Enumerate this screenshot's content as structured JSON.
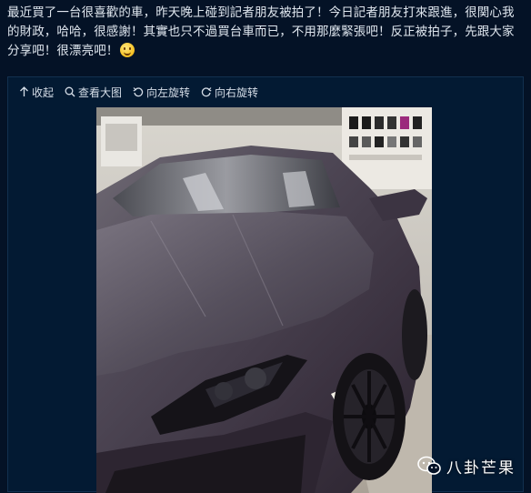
{
  "post": {
    "text": "最近買了一台很喜歡的車，昨天晚上碰到記者朋友被拍了！今日記者朋友打來跟進，很関心我的財政，哈哈，很感謝！其實也只不過買台車而已，不用那麼緊張吧！反正被拍子，先跟大家分享吧！很漂亮吧！",
    "emoji": "smile-emoji"
  },
  "toolbar": {
    "collapse_label": "收起",
    "view_large_label": "查看大图",
    "rotate_left_label": "向左旋转",
    "rotate_right_label": "向右旋转"
  },
  "photo": {
    "subject": "matte purple sports car"
  },
  "watermark": {
    "text": "八卦芒果",
    "icon": "wechat-icon"
  },
  "colors": {
    "background": "#041226",
    "text": "#dfe6ee",
    "toolbar_text": "#d6dee8"
  }
}
